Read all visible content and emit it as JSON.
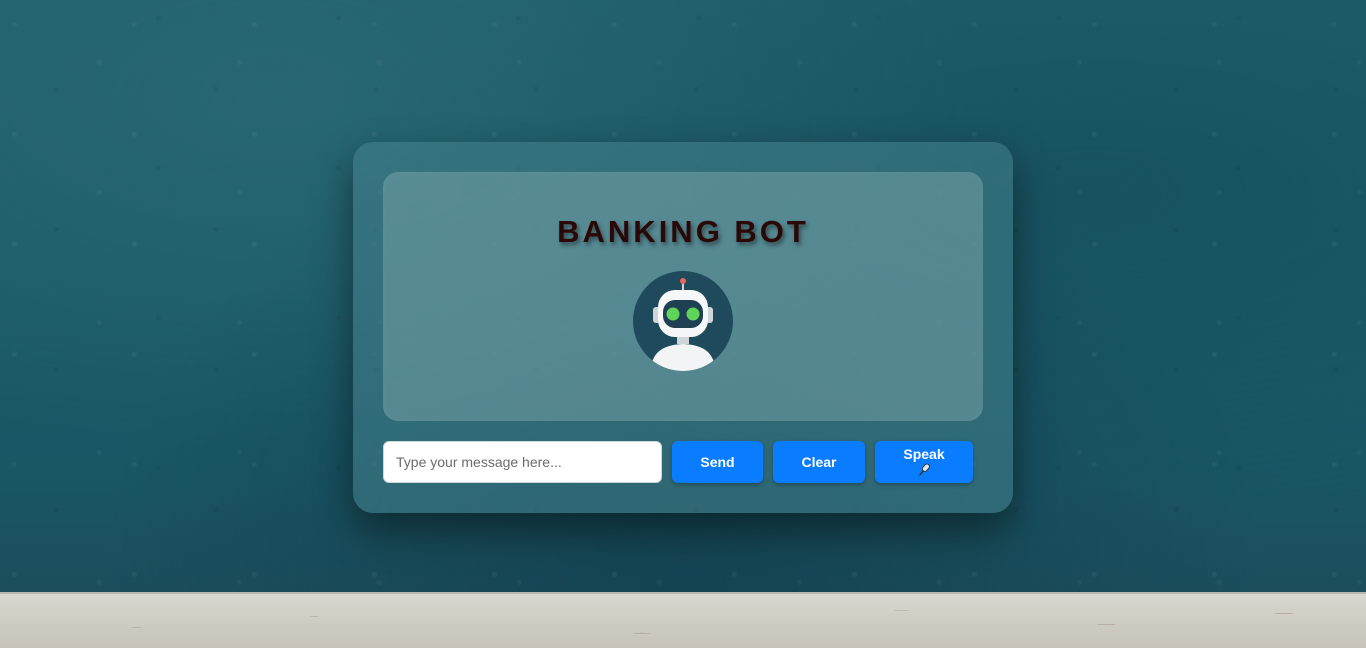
{
  "app": {
    "title": "BANKING BOT"
  },
  "chat": {
    "avatar_icon": "robot-icon"
  },
  "composer": {
    "placeholder": "Type your message here...",
    "value": "",
    "send_label": "Send",
    "clear_label": "Clear",
    "speak_label": "Speak",
    "speak_icon": "microphone-icon"
  },
  "colors": {
    "button_accent": "#0a7cff",
    "title_color": "#2a0808",
    "robot_eye": "#5fd35a",
    "robot_antenna": "#e8665a"
  }
}
